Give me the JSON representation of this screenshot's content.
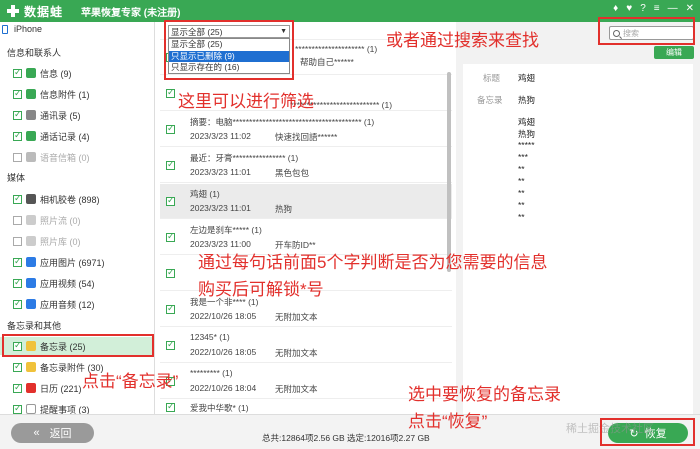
{
  "app": {
    "logo_text": "数据蛙",
    "title": "苹果恢复专家 (未注册)",
    "controls": [
      "♦",
      "♥",
      "?",
      "≡",
      "—",
      "✕"
    ]
  },
  "colors": {
    "brand": "#39a854",
    "annotation": "#e2302c",
    "highlight": "#1f6fd1"
  },
  "sidebar": {
    "device": "iPhone",
    "categories": [
      {
        "title": "信息和联系人",
        "items": [
          {
            "label": "信息 (9)",
            "checked": true,
            "icon": "message-icon"
          },
          {
            "label": "信息附件 (1)",
            "checked": true,
            "icon": "attachment-icon"
          },
          {
            "label": "通讯录 (5)",
            "checked": true,
            "icon": "contacts-icon"
          },
          {
            "label": "通话记录 (4)",
            "checked": true,
            "icon": "phone-icon"
          },
          {
            "label": "语音信箱 (0)",
            "checked": false,
            "icon": "voicemail-icon"
          }
        ]
      },
      {
        "title": "媒体",
        "items": [
          {
            "label": "相机胶卷 (898)",
            "checked": true,
            "icon": "camera-icon"
          },
          {
            "label": "照片流 (0)",
            "checked": false,
            "icon": "photostream-icon"
          },
          {
            "label": "照片库 (0)",
            "checked": false,
            "icon": "photolibrary-icon"
          },
          {
            "label": "应用图片 (6971)",
            "checked": true,
            "icon": "app-image-icon"
          },
          {
            "label": "应用视频 (54)",
            "checked": true,
            "icon": "app-video-icon"
          },
          {
            "label": "应用音频 (12)",
            "checked": true,
            "icon": "app-audio-icon"
          }
        ]
      },
      {
        "title": "备忘录和其他",
        "items": [
          {
            "label": "备忘录 (25)",
            "checked": true,
            "icon": "notes-icon"
          },
          {
            "label": "备忘录附件 (30)",
            "checked": true,
            "icon": "notes-attachment-icon"
          },
          {
            "label": "日历 (221)",
            "checked": true,
            "icon": "calendar-icon"
          },
          {
            "label": "提醒事项 (3)",
            "checked": true,
            "icon": "reminder-icon"
          }
        ]
      }
    ]
  },
  "filter": {
    "selected": "显示全部 (25)",
    "options": [
      "显示全部 (25)",
      "只显示已删除 (9)",
      "只显示存在的 (16)"
    ]
  },
  "messages": [
    {
      "line1": "********************* (1)",
      "date": "",
      "preview": "帮助自己******"
    },
    {
      "line1": "*************************** (1)",
      "date": "",
      "preview": ""
    },
    {
      "line1": "摘要：电脑*************************************** (1)",
      "date": "2023/3/23 11:02",
      "preview": "快速找回語******"
    },
    {
      "line1": "最近：牙膏**************** (1)",
      "date": "2023/3/23 11:01",
      "preview": "黑色包包"
    },
    {
      "line1": "鸡翅 (1)",
      "date": "2023/3/23 11:01",
      "preview": "热狗"
    },
    {
      "line1": "左边是刹车***** (1)",
      "date": "2023/3/23 11:00",
      "preview": "开车防ID**"
    },
    {
      "line1": "",
      "date": "",
      "preview": ""
    },
    {
      "line1": "我是一个非**** (1)",
      "date": "2022/10/26 18:05",
      "preview": "无附加文本"
    },
    {
      "line1": "12345* (1)",
      "date": "2022/10/26 18:05",
      "preview": "无附加文本"
    },
    {
      "line1": "********* (1)",
      "date": "2022/10/26 18:04",
      "preview": "无附加文本"
    },
    {
      "line1": "爱我中华歌* (1)",
      "date": "",
      "preview": ""
    }
  ],
  "detail": {
    "search_placeholder": "搜索",
    "edit_label": "编辑",
    "title_label": "标题",
    "title_value": "鸡翅",
    "note_label": "备忘录",
    "note_value": "热狗",
    "body_lines": [
      "鸡翅",
      "热狗",
      "*****",
      "***",
      "**",
      "**",
      "**",
      "**",
      "**"
    ]
  },
  "bottom": {
    "back_label": "返回",
    "status": "总共:12864项2.56 GB 选定:12016项2.27 GB",
    "recover_label": "恢复",
    "watermark": "稀土掘金技术社区"
  },
  "annotations": {
    "filter_tip": "这里可以进行筛选",
    "search_tip": "或者通过搜索来查找",
    "judge_tip": "通过每句话前面5个字判断是否为您需要的信息",
    "unlock_tip": "购买后可解锁*号",
    "click_notes_tip": "点击“备忘录”",
    "select_notes_tip": "选中要恢复的备忘录",
    "click_recover_tip": "点击“恢复”"
  }
}
